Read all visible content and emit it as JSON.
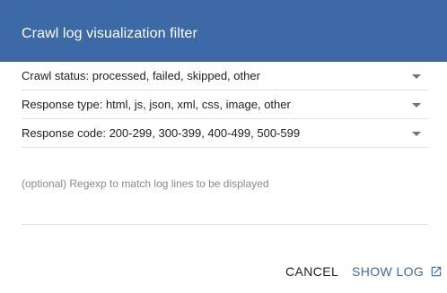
{
  "dialog": {
    "title": "Crawl log visualization filter",
    "accent_color": "#3d6aa6"
  },
  "filters": [
    {
      "value": "Crawl status: processed, failed, skipped, other"
    },
    {
      "value": "Response type: html, js, json, xml, css, image, other"
    },
    {
      "value": "Response code: 200-299, 300-399, 400-499, 500-599"
    }
  ],
  "regexp": {
    "placeholder": "(optional) Regexp to match log lines to be displayed",
    "value": ""
  },
  "actions": {
    "cancel_label": "CANCEL",
    "show_log_label": "SHOW LOG",
    "show_log_icon": "open-in-new-icon"
  }
}
